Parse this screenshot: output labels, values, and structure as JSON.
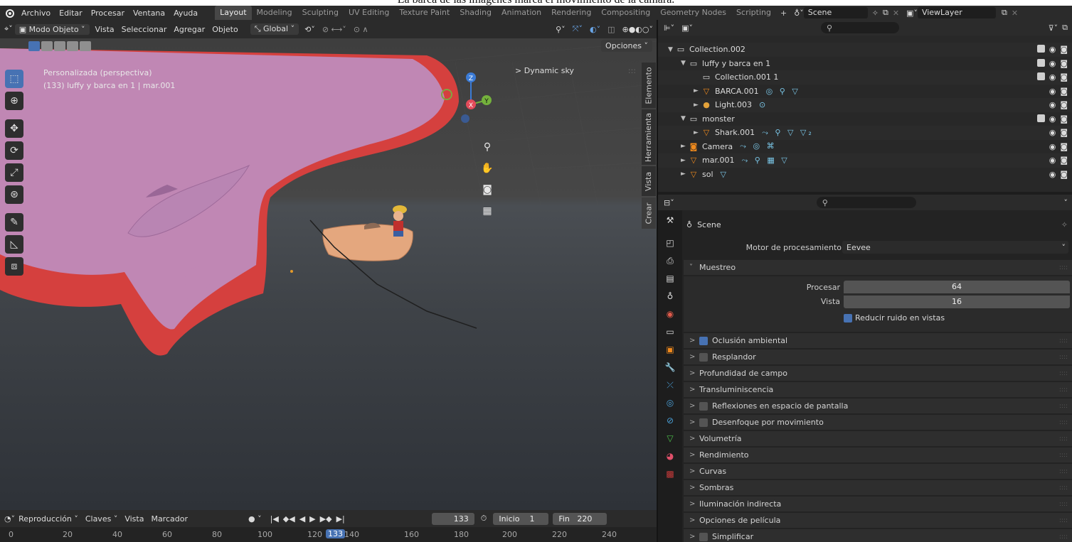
{
  "caption": "La barca de las imágenes marca el movimiento de la cámara.",
  "topbar": {
    "menus": [
      "Archivo",
      "Editar",
      "Procesar",
      "Ventana",
      "Ayuda"
    ],
    "workspaces": [
      "Layout",
      "Modeling",
      "Sculpting",
      "UV Editing",
      "Texture Paint",
      "Shading",
      "Animation",
      "Rendering",
      "Compositing",
      "Geometry Nodes",
      "Scripting"
    ],
    "active_workspace": "Layout",
    "scene": "Scene",
    "view_layer": "ViewLayer"
  },
  "viewport": {
    "mode": "Modo Objeto",
    "menus": [
      "Vista",
      "Seleccionar",
      "Agregar",
      "Objeto"
    ],
    "orientation": "Global",
    "options_label": "Opciones",
    "view_name": "Personalizada (perspectiva)",
    "object_info": "(133) luffy y barca en 1 | mar.001",
    "npanel_title": "Dynamic sky",
    "side_tabs": [
      "Elemento",
      "Herramienta",
      "Vista",
      "Crear"
    ],
    "gizmo": {
      "z": "Z",
      "x": "X",
      "y": "Y"
    }
  },
  "timeline": {
    "menus": [
      "Reproducción",
      "Claves",
      "Vista",
      "Marcador"
    ],
    "current_frame": "133",
    "start_label": "Inicio",
    "start_value": "1",
    "end_label": "Fin",
    "end_value": "220",
    "ticks": [
      "0",
      "20",
      "40",
      "60",
      "80",
      "100",
      "120",
      "140",
      "160",
      "180",
      "200",
      "220",
      "240"
    ]
  },
  "outliner": {
    "rows": [
      {
        "name": "Collection.002",
        "icon": "collection-icon",
        "indent": 0,
        "mods": "",
        "vis": "check"
      },
      {
        "name": "luffy y barca en 1",
        "icon": "collection-icon",
        "indent": 1,
        "mods": "",
        "vis": "check"
      },
      {
        "name": "Collection.001 1",
        "icon": "collection-icon",
        "indent": 2,
        "mods": "",
        "vis": "check"
      },
      {
        "name": "BARCA.001",
        "icon": "mesh-icon",
        "indent": 2,
        "mods": "◎ ⚲ ▽",
        "vis": "eye"
      },
      {
        "name": "Light.003",
        "icon": "light-icon",
        "indent": 2,
        "mods": "⊙",
        "vis": "eye"
      },
      {
        "name": "monster",
        "icon": "collection-icon",
        "indent": 1,
        "mods": "",
        "vis": "check"
      },
      {
        "name": "Shark.001",
        "icon": "mesh-icon",
        "indent": 2,
        "mods": "⤳ ⚲ ▽ ▽₂",
        "vis": "eye"
      },
      {
        "name": "Camera",
        "icon": "camera-icon",
        "indent": 1,
        "mods": "⤳ ◎ ⌘",
        "vis": "eye"
      },
      {
        "name": "mar.001",
        "icon": "mesh-icon",
        "indent": 1,
        "mods": "⤳ ⚲ ▦ ▽",
        "vis": "eye"
      },
      {
        "name": "sol",
        "icon": "mesh-icon",
        "indent": 1,
        "mods": "▽",
        "vis": "eye"
      }
    ]
  },
  "properties": {
    "scene_name": "Scene",
    "engine_label": "Motor de procesamiento",
    "engine_value": "Eevee",
    "muestreo": "Muestreo",
    "procesar_label": "Procesar",
    "procesar_value": "64",
    "vista_label": "Vista",
    "vista_value": "16",
    "reducir": "Reducir ruido en vistas",
    "panels": [
      {
        "label": "Oclusión ambiental",
        "cb": "on"
      },
      {
        "label": "Resplandor",
        "cb": "off"
      },
      {
        "label": "Profundidad de campo",
        "cb": "none"
      },
      {
        "label": "Transluminiscencia",
        "cb": "none"
      },
      {
        "label": "Reflexiones en espacio de pantalla",
        "cb": "off"
      },
      {
        "label": "Desenfoque por movimiento",
        "cb": "off"
      },
      {
        "label": "Volumetría",
        "cb": "none"
      },
      {
        "label": "Rendimiento",
        "cb": "none"
      },
      {
        "label": "Curvas",
        "cb": "none"
      },
      {
        "label": "Sombras",
        "cb": "none"
      },
      {
        "label": "Iluminación indirecta",
        "cb": "none"
      },
      {
        "label": "Opciones de película",
        "cb": "none"
      },
      {
        "label": "Simplificar",
        "cb": "off"
      }
    ]
  }
}
